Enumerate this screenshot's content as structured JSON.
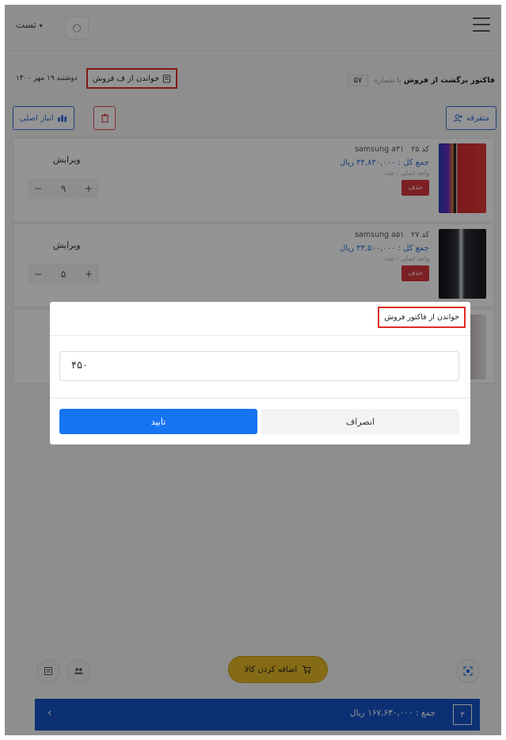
{
  "header": {
    "user_label": "تست",
    "user_caret": "▾",
    "refresh_glyph": "○"
  },
  "info": {
    "date": "دوشنبه ۱۹ مهر ۱۴۰۰",
    "read_invoice_label": "خواندن از ف فروش",
    "return_title_bold": "فاکتور برگشت از فروش",
    "number_prefix": "با شماره",
    "number": "۵۷"
  },
  "toolbar": {
    "warehouse_label": "انبار اصلی",
    "misc_label": "متفرقه"
  },
  "items": [
    {
      "name": "samsung a۳۱",
      "code": "کد ۲۵",
      "total": "جمع کل : ۳۴,۸۳۰,۰۰۰ ریال",
      "unit": "واحد اصلی : عدد",
      "delete_label": "حذف",
      "edit_label": "ویرایش",
      "qty": "۹"
    },
    {
      "name": "samsung a۵۱",
      "code": "کد ۲۷",
      "total": "جمع کل : ۳۳,۵۰۰,۰۰۰ ریال",
      "unit": "واحد اصلی : عدد",
      "delete_label": "حذف",
      "edit_label": "ویرایش",
      "qty": "۵"
    }
  ],
  "modal": {
    "title": "خواندن از فاکتور فروش",
    "input_value": "۴۵۰",
    "confirm_label": "تایید",
    "cancel_label": "انصراف"
  },
  "bottom": {
    "add_product_label": "اضافه کردن کالا",
    "total_text": "جمع : ۱۶۷,۶۳۰,۰۰۰ ریال",
    "count": "۳",
    "chevron": "‹"
  },
  "stepper": {
    "minus": "−",
    "plus": "+"
  },
  "colors": {
    "primary": "#1673f2",
    "accent_blue": "#2f6fd6",
    "danger": "#d8383f",
    "highlight_red": "#e02b2b",
    "add_button": "#e6b826",
    "total_bar": "#1554c7"
  }
}
